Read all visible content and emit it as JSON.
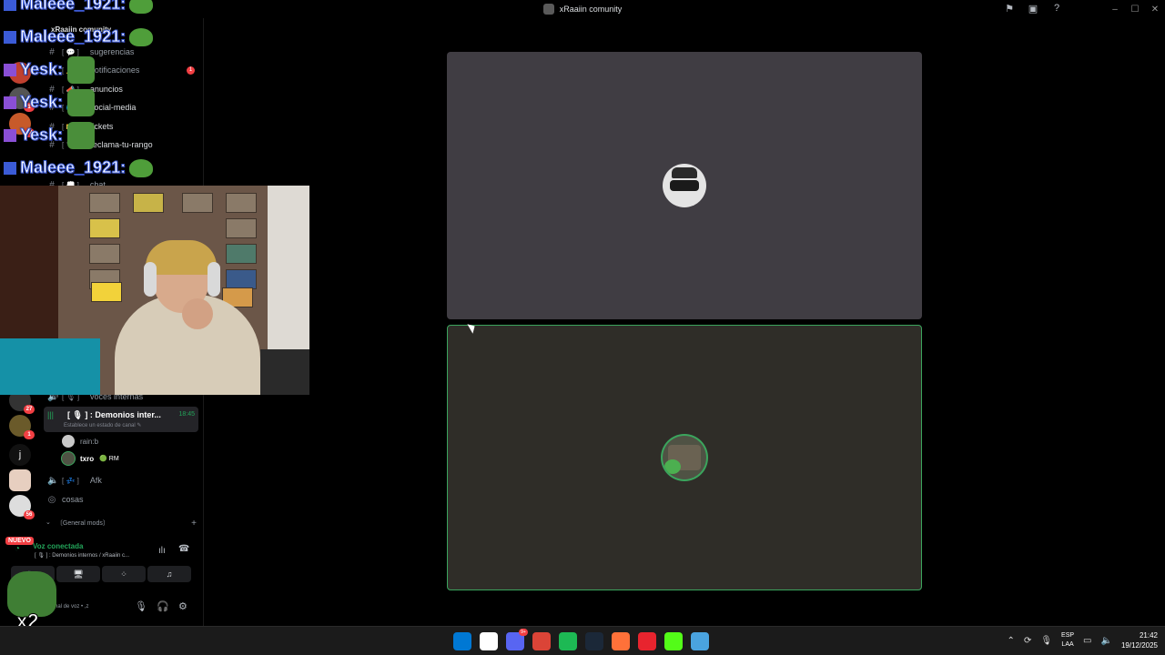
{
  "window": {
    "title": "xRaaiin comunity",
    "actions": [
      "flag-icon",
      "window-icon",
      "help-icon"
    ],
    "controls": [
      "minimize",
      "maximize",
      "close"
    ]
  },
  "overlay_chat": [
    {
      "user": "Maleee_1921:"
    },
    {
      "user": "Maleee_1921:"
    },
    {
      "user": "Yesk:"
    },
    {
      "user": "Yesk:"
    },
    {
      "user": "Yesk:"
    },
    {
      "user": "Maleee_1921:"
    }
  ],
  "overlay_multiplier": "x2",
  "sidebar": {
    "server_name": "xRaaiin comunity",
    "channels": [
      {
        "name": "sugerencias",
        "type": "text"
      },
      {
        "name": "notificaciones",
        "type": "text",
        "badge": "1"
      },
      {
        "name": "anuncios",
        "type": "text"
      },
      {
        "name": "social-media",
        "type": "text"
      },
      {
        "name": "tickets",
        "type": "text"
      },
      {
        "name": "reclama-tu-rango",
        "type": "text"
      },
      {
        "name": "chat",
        "type": "text"
      }
    ],
    "voice_channels_above": "voces internas",
    "active_voice": {
      "name": ": Demonios inter...",
      "time": "18:45",
      "status": "Establece un estado de canal"
    },
    "members": [
      {
        "name": "rain:b"
      },
      {
        "name": "txro",
        "tag": "RM"
      }
    ],
    "afk_channel": "Afk",
    "cosas_channel": "cosas",
    "category": "〔General mods〕"
  },
  "server_badges": [
    "27",
    "1",
    "56",
    "19"
  ],
  "server_letter": "j",
  "nuevo_label": "NUEVO",
  "voice_panel": {
    "status": "Voz conectada",
    "channel": "[ 🎙 ] : Demonios internos / xRaaiin c...",
    "user_sub": "nal de voz • ,z"
  },
  "taskbar": {
    "apps": [
      {
        "name": "windows-start",
        "color": "#0078d4"
      },
      {
        "name": "ubisoft",
        "color": "#ffffff"
      },
      {
        "name": "discord",
        "color": "#5865f2",
        "badge": "9+"
      },
      {
        "name": "chrome",
        "color": "#db4437"
      },
      {
        "name": "spotify",
        "color": "#1db954"
      },
      {
        "name": "steam",
        "color": "#1b2838"
      },
      {
        "name": "firefox",
        "color": "#ff7139"
      },
      {
        "name": "opera",
        "color": "#e8242e"
      },
      {
        "name": "kick",
        "color": "#53fc18"
      },
      {
        "name": "notepad",
        "color": "#4aa3df"
      }
    ],
    "lang_top": "ESP",
    "lang_bottom": "LAA",
    "time": "21:42",
    "date": "19/12/2025"
  },
  "colors": {
    "accent_green": "#3ba55d",
    "notification_red": "#f23f43"
  }
}
